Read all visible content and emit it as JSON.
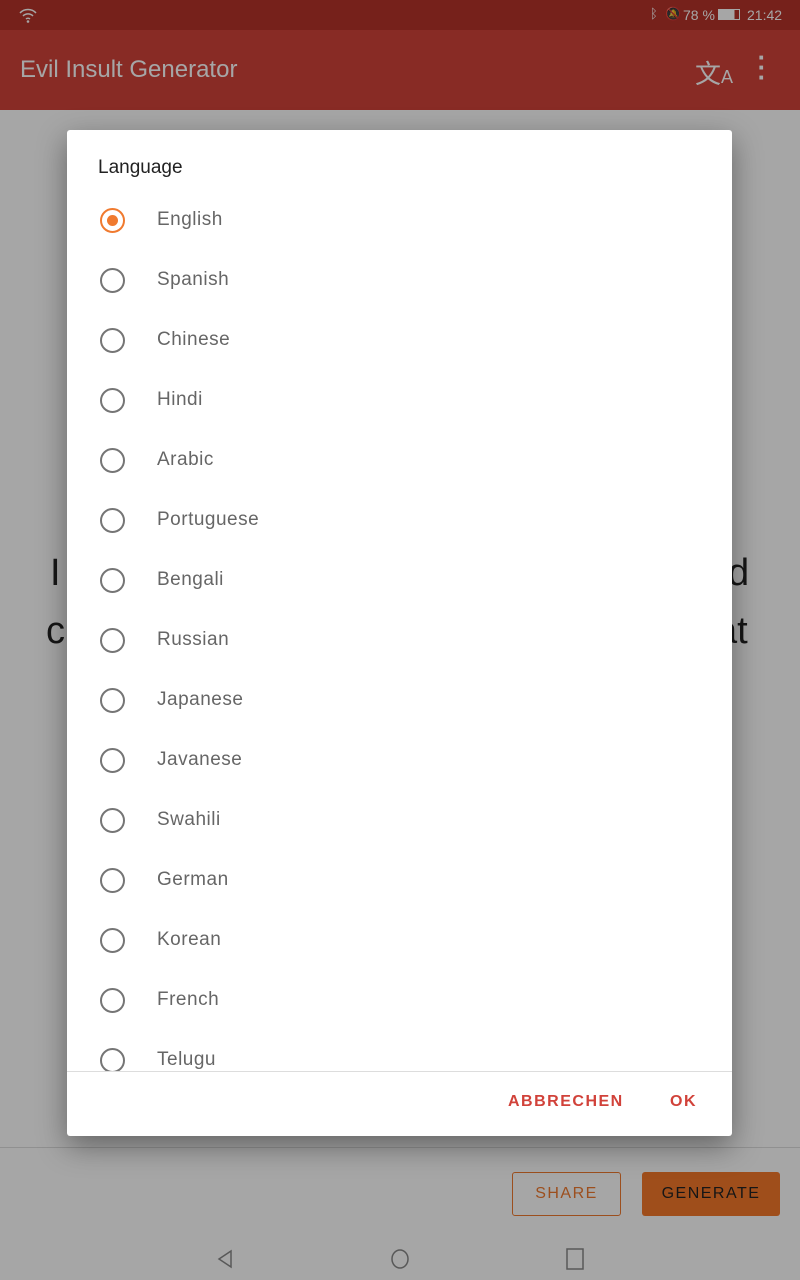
{
  "status": {
    "battery": "78 %",
    "time": "21:42"
  },
  "appbar": {
    "title": "Evil Insult Generator"
  },
  "background_text": {
    "l1_left": "I",
    "l1_right": "d",
    "l2_left": "c",
    "l2_right": "at"
  },
  "actions": {
    "share": "SHARE",
    "generate": "GENERATE"
  },
  "dialog": {
    "title": "Language",
    "selected": "English",
    "options": [
      "English",
      "Spanish",
      "Chinese",
      "Hindi",
      "Arabic",
      "Portuguese",
      "Bengali",
      "Russian",
      "Japanese",
      "Javanese",
      "Swahili",
      "German",
      "Korean",
      "French",
      "Telugu"
    ],
    "cancel": "ABBRECHEN",
    "ok": "OK"
  }
}
